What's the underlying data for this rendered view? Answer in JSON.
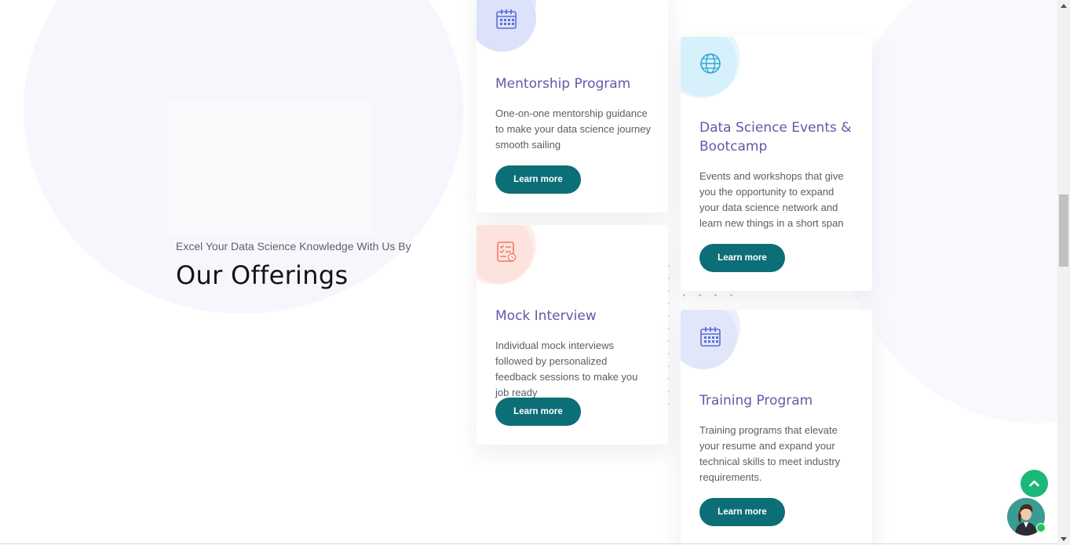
{
  "intro": {
    "subtitle": "Excel Your Data Science Knowledge With Us By",
    "title": "Our Offerings"
  },
  "cards": [
    {
      "title": "Mentorship Program",
      "description": "One-on-one mentorship guidance to make your data science journey smooth sailing",
      "button": "Learn more",
      "icon": "calendar-icon",
      "accent": "#e2e6fb"
    },
    {
      "title": "Data Science Events & Bootcamp",
      "description": "Events and workshops that give you the opportunity to expand your data science network and learn new things in a short span",
      "button": "Learn more",
      "icon": "globe-icon",
      "accent": "#dff3fb"
    },
    {
      "title": "Mock Interview",
      "description": "Individual mock interviews followed by personalized feedback sessions to make you job ready",
      "button": "Learn more",
      "icon": "checklist-icon",
      "accent": "#fde6e2"
    },
    {
      "title": "Training Program",
      "description": "Training programs that elevate your resume and expand your technical skills to meet industry requirements.",
      "button": "Learn more",
      "icon": "calendar-icon",
      "accent": "#e6e9fb"
    }
  ],
  "colors": {
    "heading": "#6558a8",
    "button": "#0c6e76",
    "back_to_top": "#1cb878"
  },
  "widgets": {
    "back_to_top_icon": "chevron-up-icon",
    "chat_icon": "support-agent-avatar"
  }
}
